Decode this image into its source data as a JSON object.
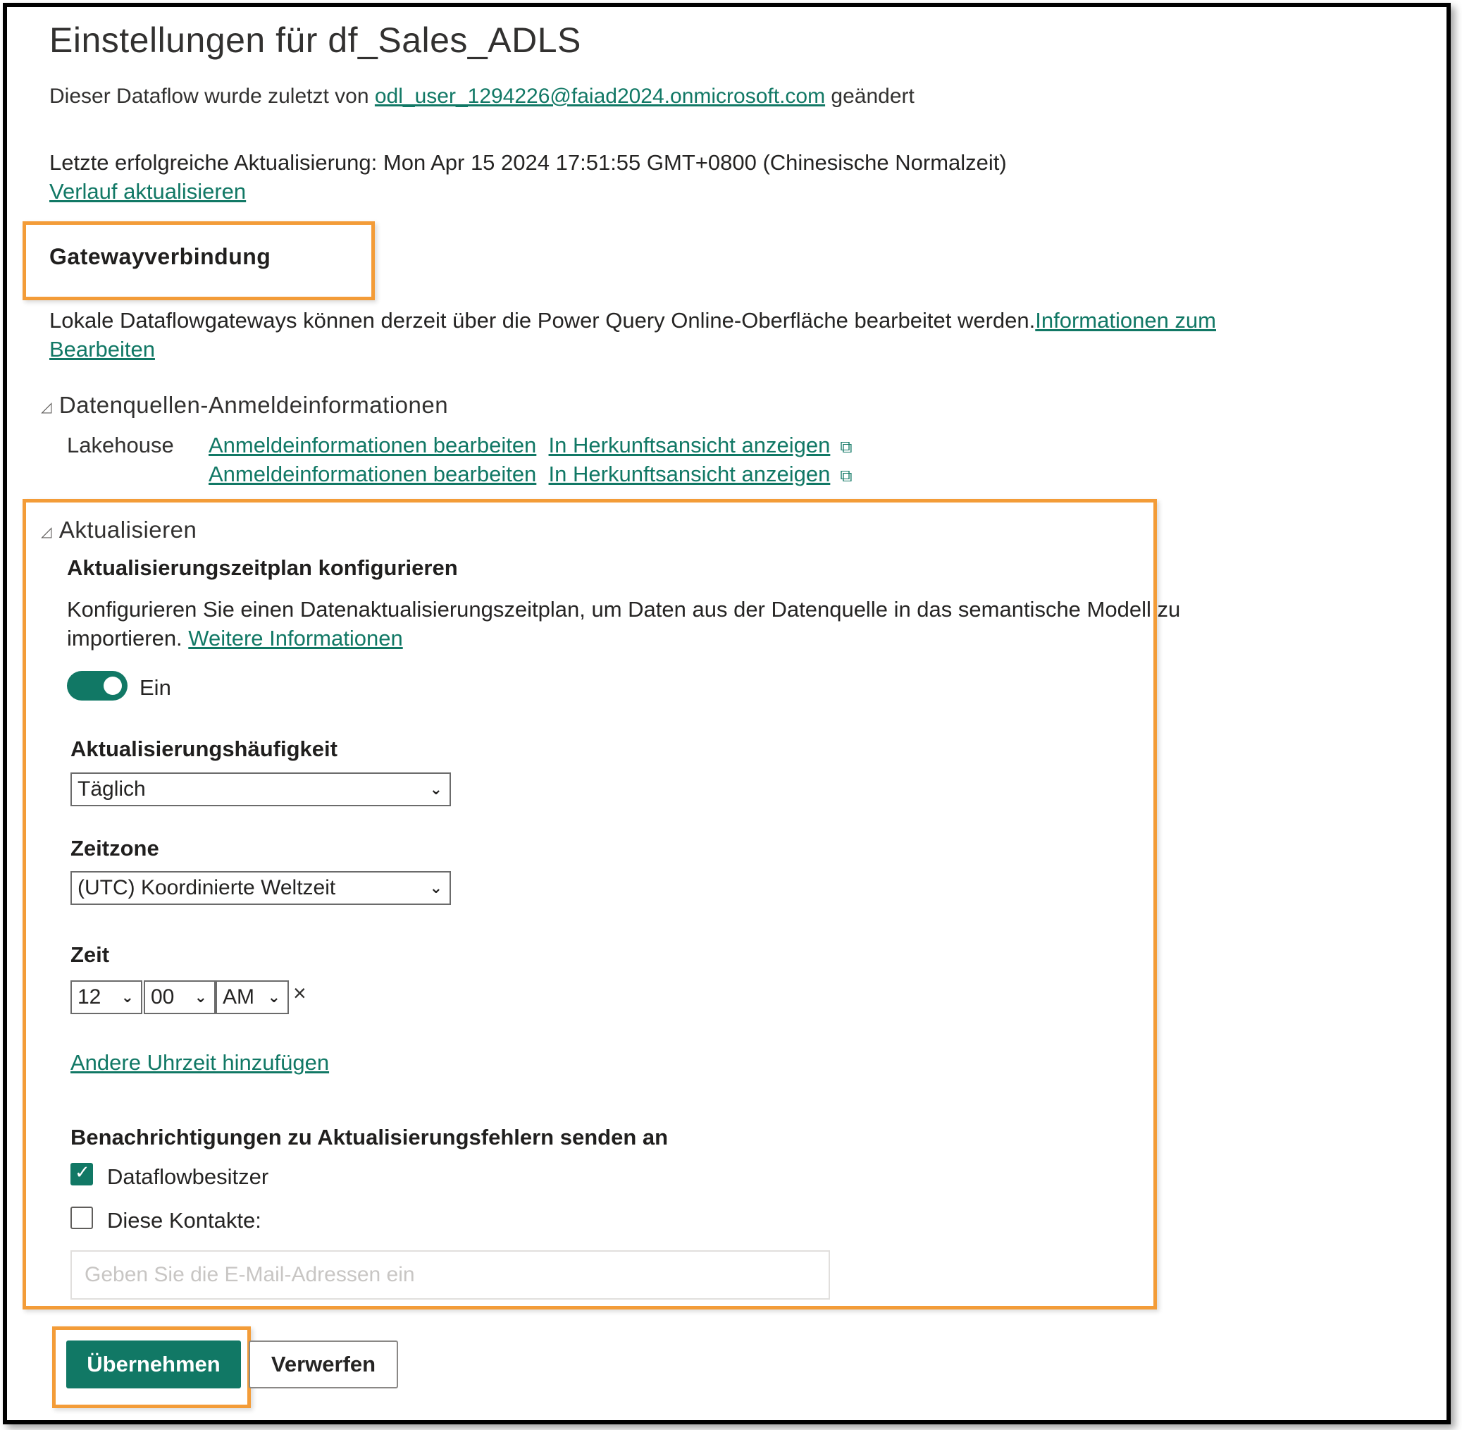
{
  "page": {
    "title": "Einstellungen für df_Sales_ADLS",
    "modified_prefix": "Dieser Dataflow wurde zuletzt von ",
    "modified_user": "odl_user_1294226@faiad2024.onmicrosoft.com",
    "modified_suffix": " geändert",
    "last_refresh": "Letzte erfolgreiche Aktualisierung: Mon Apr 15 2024 17:51:55 GMT+0800 (Chinesische Normalzeit)",
    "refresh_history_link": "Verlauf aktualisieren"
  },
  "gateway": {
    "heading": "Gatewayverbindung",
    "info_text": "Lokale Dataflowgateways können derzeit über die Power Query Online-Oberfläche bearbeitet werden.",
    "info_link_part1": "Informationen zum",
    "info_link_part2": "Bearbeiten"
  },
  "datasources": {
    "heading": "Datenquellen-Anmeldeinformationen",
    "source_name": "Lakehouse",
    "rows": [
      {
        "edit_link": "Anmeldeinformationen bearbeiten",
        "lineage_link": "In Herkunftsansicht anzeigen"
      },
      {
        "edit_link": "Anmeldeinformationen bearbeiten",
        "lineage_link": "In Herkunftsansicht anzeigen"
      }
    ]
  },
  "refresh": {
    "heading": "Aktualisieren",
    "schedule_heading": "Aktualisierungszeitplan konfigurieren",
    "desc_line1": "Konfigurieren Sie einen Datenaktualisierungszeitplan, um Daten aus der Datenquelle in das semantische Modell zu",
    "desc_line2": "importieren. ",
    "more_info_link": "Weitere Informationen",
    "toggle_label": "Ein",
    "toggle_on": true,
    "frequency_label": "Aktualisierungshäufigkeit",
    "frequency_value": "Täglich",
    "timezone_label": "Zeitzone",
    "timezone_value": "(UTC) Koordinierte Weltzeit",
    "time_label": "Zeit",
    "time_hour": "12",
    "time_minute": "00",
    "time_ampm": "AM",
    "clear_icon": "×",
    "add_time_link": "Andere Uhrzeit hinzufügen",
    "notify_label": "Benachrichtigungen zu Aktualisierungsfehlern senden an",
    "owner_checkbox_label": "Dataflowbesitzer",
    "owner_checked": true,
    "contacts_checkbox_label": "Diese Kontakte:",
    "contacts_checked": false,
    "email_placeholder": "Geben Sie die E-Mail-Adressen ein"
  },
  "actions": {
    "apply_label": "Übernehmen",
    "discard_label": "Verwerfen"
  },
  "icons": {
    "collapse": "◿",
    "external": "⧉",
    "chevron": "⌄",
    "check": "✓"
  },
  "colors": {
    "accent": "#117865",
    "highlight": "#F39C38"
  }
}
